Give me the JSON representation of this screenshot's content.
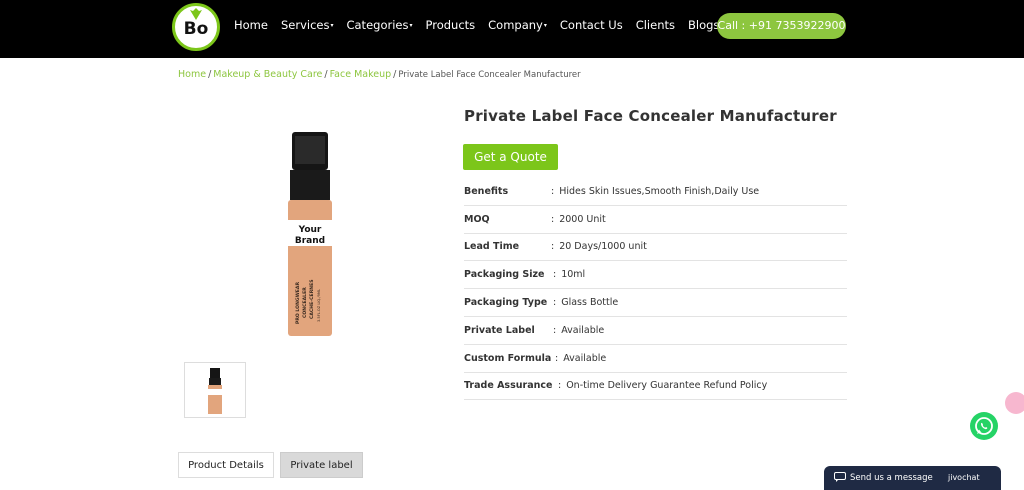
{
  "header": {
    "logo_text": "Bo",
    "menu": [
      {
        "label": "Home",
        "has_caret": false
      },
      {
        "label": "Services",
        "has_caret": true
      },
      {
        "label": "Categories",
        "has_caret": true
      },
      {
        "label": "Products",
        "has_caret": false
      },
      {
        "label": "Company",
        "has_caret": true
      },
      {
        "label": "Contact Us",
        "has_caret": false
      },
      {
        "label": "Clients",
        "has_caret": false
      },
      {
        "label": "Blogs",
        "has_caret": true
      }
    ],
    "caret_glyph": "▾",
    "call_button": "Call : +91 7353922900"
  },
  "breadcrumb": {
    "items": [
      "Home",
      "Makeup & Beauty Care",
      "Face Makeup"
    ],
    "separator": "/",
    "current": "Private Label Face Concealer Manufacturer"
  },
  "product": {
    "title": "Private Label Face Concealer Manufacturer",
    "quote_button": "Get a Quote",
    "image_label_line1": "Your",
    "image_label_line2": "Brand",
    "image_print_1": "PRO LONGWEAR",
    "image_print_2": "CONCEALER",
    "image_print_3": "CACHE-CERNES",
    "image_print_4": "3.5FL.OZ LIQ./9ML",
    "specs": [
      {
        "label": "Benefits",
        "value": "Hides Skin Issues,Smooth Finish,Daily Use"
      },
      {
        "label": "MOQ",
        "value": "2000 Unit"
      },
      {
        "label": "Lead Time",
        "value": "20 Days/1000 unit"
      },
      {
        "label": "Packaging Size",
        "value": "10ml"
      },
      {
        "label": "Packaging Type",
        "value": "Glass Bottle"
      },
      {
        "label": "Private Label",
        "value": "Available"
      },
      {
        "label": "Custom Formula",
        "value": "Available"
      },
      {
        "label": "Trade Assurance",
        "value": "On-time Delivery Guarantee Refund Policy"
      }
    ],
    "colon": ":"
  },
  "tabs": {
    "details": "Product Details",
    "private": "Private label"
  },
  "chat": {
    "label": "Send us a message",
    "brand": "jivochat"
  },
  "colors": {
    "accent_green": "#8dc63f",
    "nav_background": "#000000",
    "chat_background": "#1f2a44",
    "whatsapp": "#25d366"
  }
}
